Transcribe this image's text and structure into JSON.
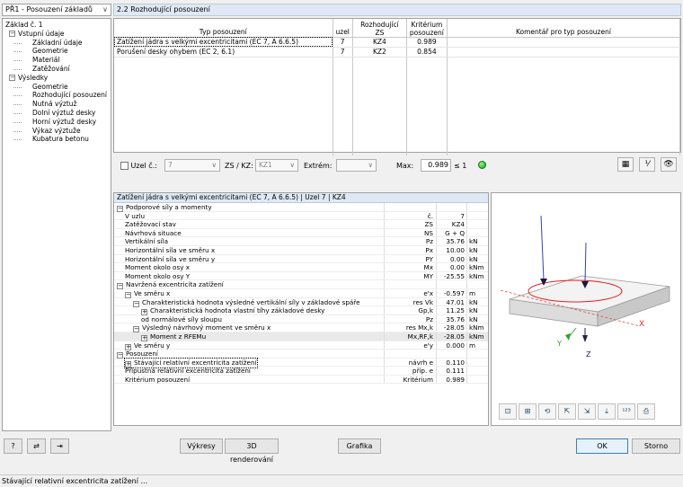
{
  "nav": {
    "combo": "PŘ1 - Posouzení základů"
  },
  "tree": [
    {
      "label": "Základ č. 1",
      "level": 0,
      "box": ""
    },
    {
      "label": "Vstupní údaje",
      "level": 1,
      "box": "−"
    },
    {
      "label": "Základní údaje",
      "level": 2,
      "box": ""
    },
    {
      "label": "Geometrie",
      "level": 2,
      "box": ""
    },
    {
      "label": "Materiál",
      "level": 2,
      "box": ""
    },
    {
      "label": "Zatěžování",
      "level": 2,
      "box": ""
    },
    {
      "label": "Výsledky",
      "level": 1,
      "box": "−"
    },
    {
      "label": "Geometrie",
      "level": 2,
      "box": ""
    },
    {
      "label": "Rozhodující posouzení",
      "level": 2,
      "box": ""
    },
    {
      "label": "Nutná výztuž",
      "level": 2,
      "box": ""
    },
    {
      "label": "Dolní výztuž desky",
      "level": 2,
      "box": ""
    },
    {
      "label": "Horní výztuž desky",
      "level": 2,
      "box": ""
    },
    {
      "label": "Výkaz výztuže",
      "level": 2,
      "box": ""
    },
    {
      "label": "Kubatura betonu",
      "level": 2,
      "box": ""
    }
  ],
  "section_title": "2.2 Rozhodující posouzení",
  "top_table": {
    "headers": {
      "type": "Typ posouzení",
      "node": "uzel",
      "zs_top": "Rozhodující",
      "zs": "ZS",
      "crit_top": "Kritérium",
      "crit": "posouzení",
      "comment": "Komentář pro typ posouzení"
    },
    "rows": [
      {
        "type": "Zatížení jádra s velkými excentricitami (EC 7, A 6.6.5)",
        "node": "7",
        "zs": "KZ4",
        "crit": "0.989",
        "comment": ""
      },
      {
        "type": "Porušení desky ohybem (EC 2, 6.1)",
        "node": "7",
        "zs": "KZ2",
        "crit": "0.854",
        "comment": ""
      }
    ]
  },
  "filter": {
    "node_label": "Uzel č.:",
    "node_value": "7",
    "zs_label": "ZS / KZ:",
    "zs_value": "KZ1",
    "extrem_label": "Extrém:",
    "extrem_value": "",
    "max_label": "Max:",
    "max_value": "0.989",
    "max_cond": "≤ 1"
  },
  "detail": {
    "header": "Zatížení jádra s velkými excentricitami (EC 7, A 6.6.5) | Uzel 7 | KZ4",
    "rows": [
      {
        "label": "Podporové síly a momenty",
        "lvl": 0,
        "box": "−",
        "sym": "",
        "val": "",
        "unit": ""
      },
      {
        "label": "V uzlu",
        "lvl": 1,
        "box": "",
        "sym": "č.",
        "val": "7",
        "unit": ""
      },
      {
        "label": "Zatěžovací stav",
        "lvl": 1,
        "box": "",
        "sym": "ZS",
        "val": "KZ4",
        "unit": ""
      },
      {
        "label": "Návrhová situace",
        "lvl": 1,
        "box": "",
        "sym": "NS",
        "val": "G + Q",
        "unit": ""
      },
      {
        "label": "Vertikální síla",
        "lvl": 1,
        "box": "",
        "sym": "Pz",
        "val": "35.76",
        "unit": "kN"
      },
      {
        "label": "Horizontální síla ve směru x",
        "lvl": 1,
        "box": "",
        "sym": "Px",
        "val": "10.00",
        "unit": "kN"
      },
      {
        "label": "Horizontální síla ve směru y",
        "lvl": 1,
        "box": "",
        "sym": "PY",
        "val": "0.00",
        "unit": "kN"
      },
      {
        "label": "Moment okolo osy x",
        "lvl": 1,
        "box": "",
        "sym": "Mx",
        "val": "0.00",
        "unit": "kNm"
      },
      {
        "label": "Moment okolo osy Y",
        "lvl": 1,
        "box": "",
        "sym": "MY",
        "val": "-25.55",
        "unit": "kNm"
      },
      {
        "label": "Navržená excentricita zatížení",
        "lvl": 0,
        "box": "−",
        "sym": "",
        "val": "",
        "unit": ""
      },
      {
        "label": "Ve směru x",
        "lvl": 1,
        "box": "−",
        "sym": "e'x",
        "val": "-0.597",
        "unit": "m"
      },
      {
        "label": "Charakteristická hodnota výsledné vertikální síly v základové spáře",
        "lvl": 2,
        "box": "−",
        "sym": "res Vk",
        "val": "47.01",
        "unit": "kN"
      },
      {
        "label": "Charakteristická hodnota vlastní tíhy základové desky",
        "lvl": 3,
        "box": "+",
        "sym": "Gp,k",
        "val": "11.25",
        "unit": "kN"
      },
      {
        "label": "od normálové síly sloupu",
        "lvl": 3,
        "box": "",
        "sym": "Pz",
        "val": "35.76",
        "unit": "kN"
      },
      {
        "label": "Výsledný návrhový moment ve směru x",
        "lvl": 2,
        "box": "−",
        "sym": "res Mx,k",
        "val": "-28.05",
        "unit": "kNm"
      },
      {
        "label": "Moment z RFEMu",
        "lvl": 3,
        "box": "+",
        "sym": "Mx,RF,k",
        "val": "-28.05",
        "unit": "kNm",
        "hl": true
      },
      {
        "label": "Ve směru y",
        "lvl": 1,
        "box": "+",
        "sym": "e'y",
        "val": "0.000",
        "unit": "m"
      },
      {
        "label": "Posouzení",
        "lvl": 0,
        "box": "−",
        "sym": "",
        "val": "",
        "unit": ""
      },
      {
        "label": "Stávající relativní excentricita zatížení",
        "lvl": 1,
        "box": "+",
        "sym": "návrh e",
        "val": "0.110",
        "unit": "",
        "focus": true
      },
      {
        "label": "Přípustná relativní excentricita zatížení",
        "lvl": 1,
        "box": "",
        "sym": "příp. e",
        "val": "0.111",
        "unit": ""
      },
      {
        "label": "Kritérium posouzení",
        "lvl": 1,
        "box": "",
        "sym": "Kritérium",
        "val": "0.989",
        "unit": ""
      }
    ]
  },
  "graphic": {
    "axis_x": "X",
    "axis_y": "Y",
    "axis_z": "Z"
  },
  "buttons": {
    "vykresy": "Výkresy",
    "render": "3D renderování",
    "grafika": "Grafika",
    "ok": "OK",
    "storno": "Storno"
  },
  "status": "Stávající relativní excentricita zatížení ..."
}
